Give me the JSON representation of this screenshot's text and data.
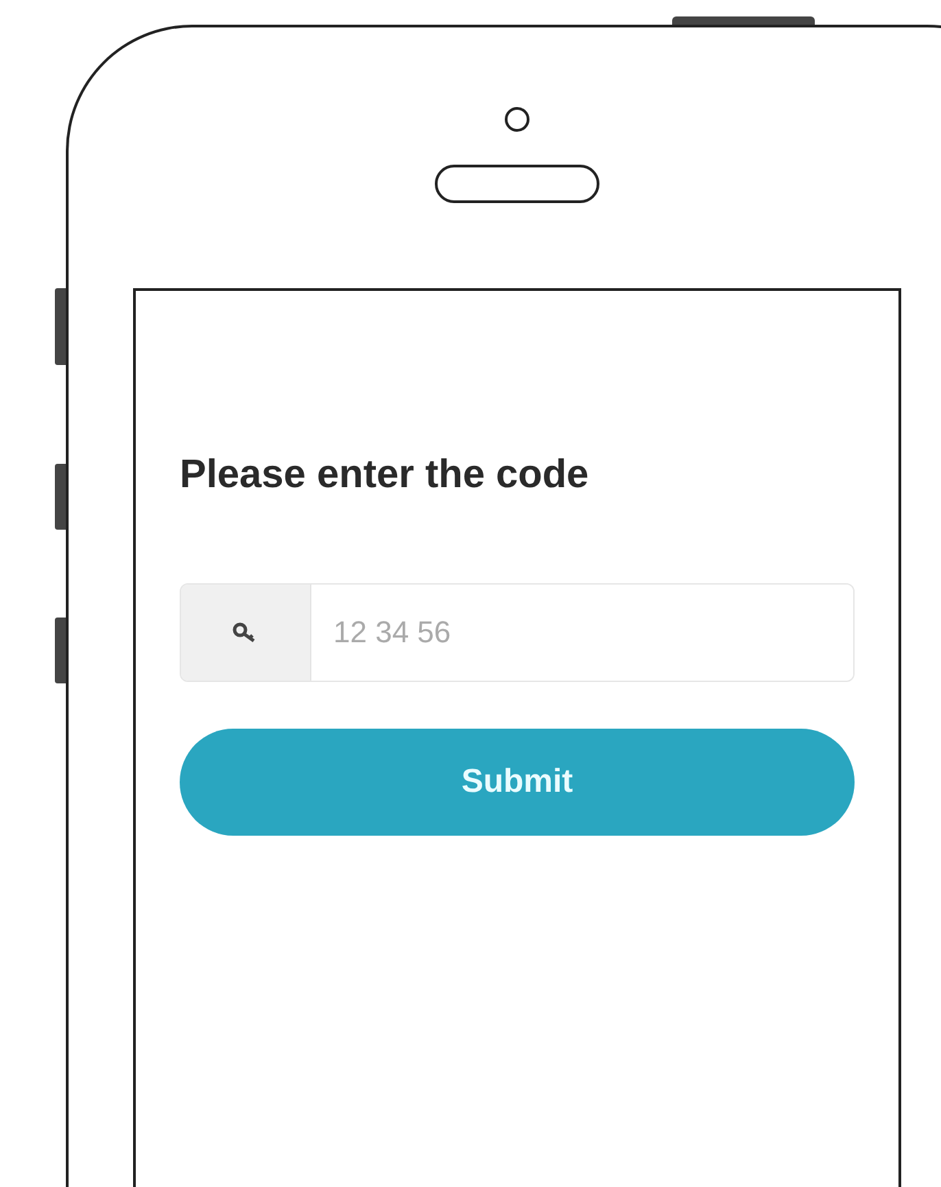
{
  "screen": {
    "heading": "Please enter the code",
    "code_field": {
      "placeholder": "12 34 56"
    },
    "submit_button": {
      "label": "Submit"
    }
  }
}
